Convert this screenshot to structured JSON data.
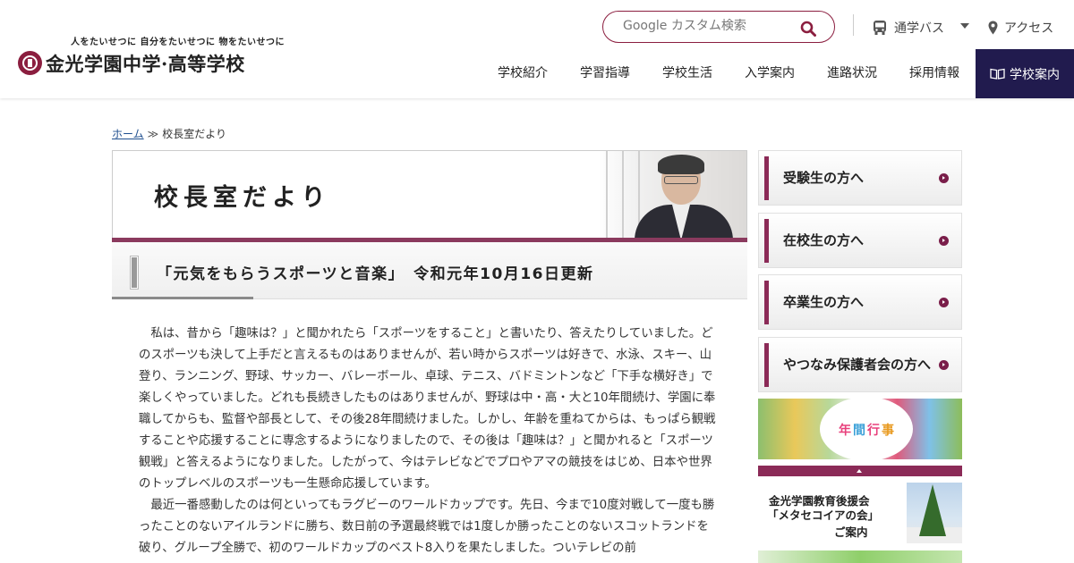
{
  "header": {
    "logo": {
      "tagline": "人をたいせつに 自分をたいせつに 物をたいせつに",
      "name": "金光学園中学·高等学校"
    },
    "search": {
      "placeholder": "Google カスタム検索"
    },
    "bus_label": "通学バス",
    "access_label": "アクセス",
    "nav": [
      "学校紹介",
      "学習指導",
      "学校生活",
      "入学案内",
      "進路状況",
      "採用情報"
    ],
    "guide_label": "学校案内",
    "accent_color": "#211b4e"
  },
  "breadcrumb": {
    "home": "ホーム",
    "separator": "≫",
    "current": "校長室だより"
  },
  "banner": {
    "title": "校長室だより"
  },
  "article": {
    "headline": "「元気をもらうスポーツと音楽」　令和元年10月16日更新",
    "paragraphs": [
      "私は、昔から「趣味は？」と聞かれたら「スポーツをすること」と書いたり、答えたりしていました。どのスポーツも決して上手だと言えるものはありませんが、若い時からスポーツは好きで、水泳、スキー、山登り、ランニング、野球、サッカー、バレーボール、卓球、テニス、バドミントンなど「下手な横好き」で楽しくやっていました。どれも長続きしたものはありませんが、野球は中・高・大と10年間続け、学園に奉職してからも、監督や部長として、その後28年間続けました。しかし、年齢を重ねてからは、もっぱら観戦することや応援することに専念するようになりましたので、その後は「趣味は？」と聞かれると「スポーツ観戦」と答えるようになりました。したがって、今はテレビなどでプロやアマの競技をはじめ、日本や世界のトップレベルのスポーツも一生懸命応援しています。",
      "最近一番感動したのは何といってもラグビーのワールドカップです。先日、今まで10度対戦して一度も勝ったことのないアイルランドに勝ち、数日前の予選最終戦では1度しか勝ったことのないスコットランドを破り、グループ全勝で、初のワールドカップのベスト8入りを果たしました。ついテレビの前"
    ]
  },
  "sidebar": {
    "buttons": [
      "受験生の方へ",
      "在校生の方へ",
      "卒業生の方へ",
      "やつなみ保護者会の方へ"
    ],
    "events": {
      "c1": "年",
      "c2": "間",
      "c3": "行",
      "c4": "事"
    },
    "meta": {
      "line1": "金光学園教育後援会",
      "line2": "「メタセコイアの会」",
      "line3": "ご案内"
    },
    "accent_color": "#8b2a57"
  }
}
